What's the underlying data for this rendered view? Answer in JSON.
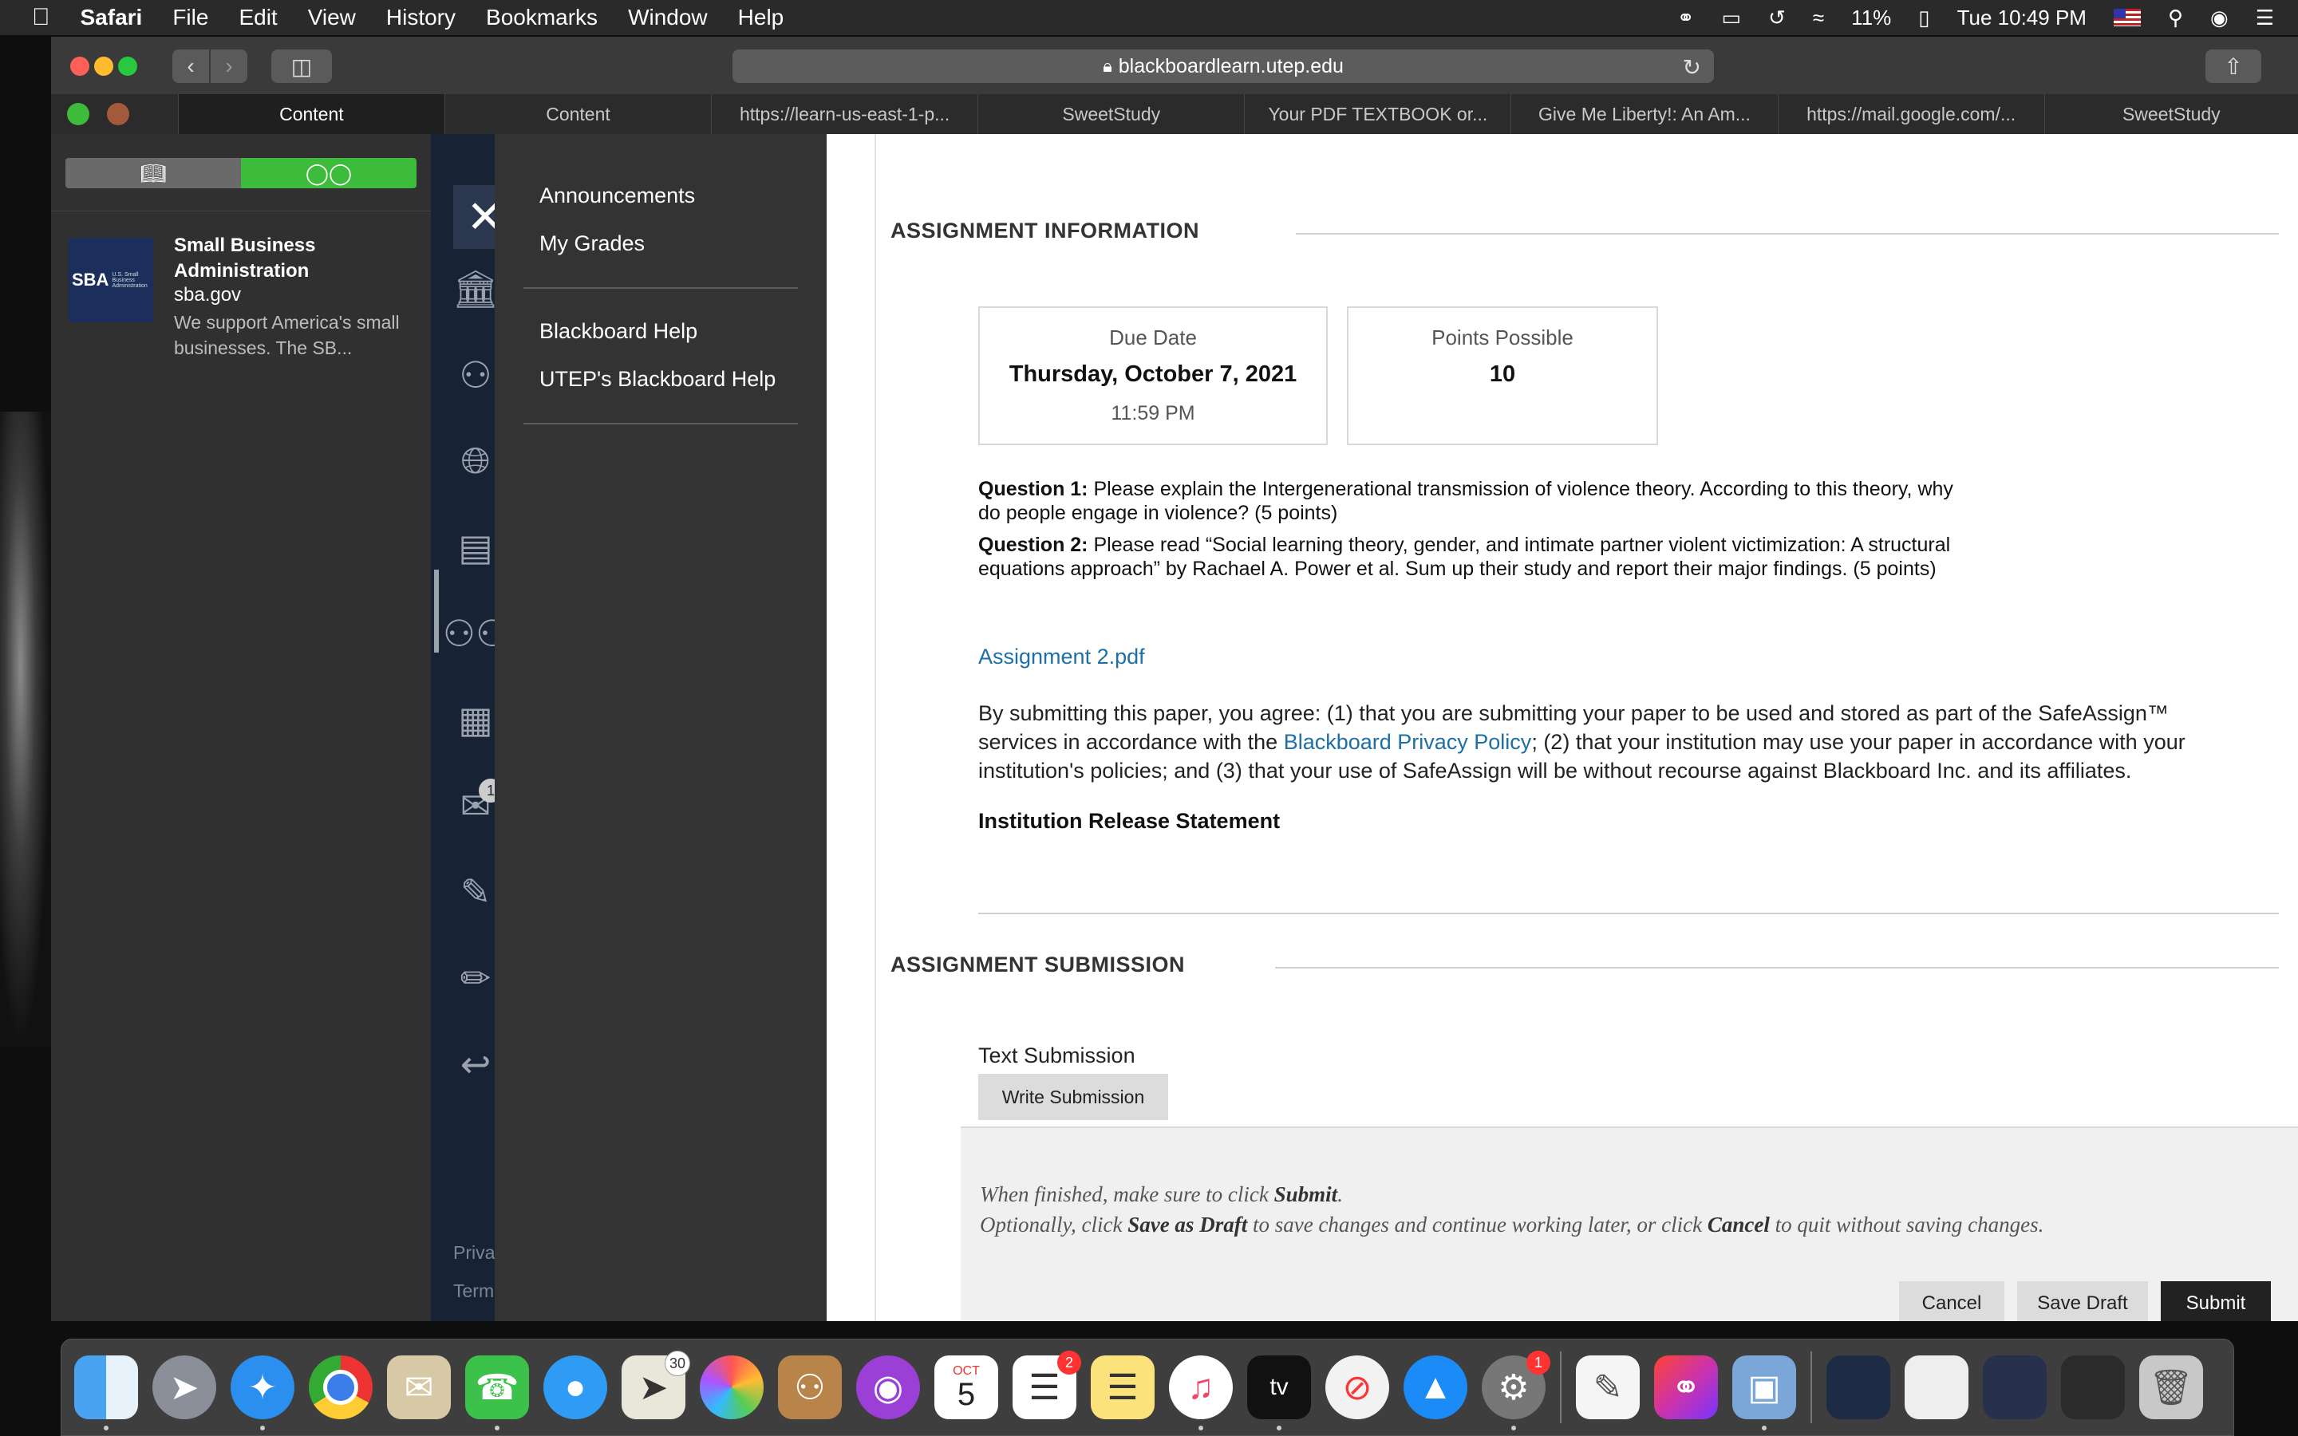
{
  "menubar": {
    "app_name": "Safari",
    "menus": [
      "File",
      "Edit",
      "View",
      "History",
      "Bookmarks",
      "Window",
      "Help"
    ],
    "battery": "11%",
    "clock": "Tue 10:49 PM"
  },
  "browser": {
    "url": "blackboardlearn.utep.edu",
    "tabs": [
      "Content",
      "Content",
      "https://learn-us-east-1-p...",
      "SweetStudy",
      "Your PDF TEXTBOOK or...",
      "Give Me Liberty!: An Am...",
      "https://mail.google.com/...",
      "SweetStudy"
    ]
  },
  "reading_list": {
    "thumb_text": "SBA",
    "thumb_small": "U.S. Small Business Administration",
    "item_title": "Small Business Administration",
    "item_domain": "sba.gov",
    "item_desc": "We support America's small businesses. The SB..."
  },
  "bb_rail": {
    "footer": [
      "Priva",
      "Term"
    ],
    "mail_badge": "1"
  },
  "bb_menu": {
    "items": [
      "Announcements",
      "My Grades",
      "Blackboard Help",
      "UTEP's Blackboard Help"
    ]
  },
  "assignment": {
    "info_heading": "ASSIGNMENT INFORMATION",
    "due_label": "Due Date",
    "due_date": "Thursday, October 7, 2021",
    "due_time": "11:59 PM",
    "points_label": "Points Possible",
    "points_value": "10",
    "q1_label": "Question 1:",
    "q1_text": " Please explain the Intergenerational transmission of violence theory. According to this theory, why do people engage in violence? (5 points)",
    "q2_label": "Question 2:",
    "q2_text": " Please read “Social learning theory, gender, and intimate partner violent victimization: A structural equations approach” by Rachael A. Power et al. Sum up their study and report their major findings. (5 points)",
    "attachment": "Assignment 2.pdf",
    "agree_before": "By submitting this paper, you agree: (1) that you are submitting your paper to be used and stored as part of the SafeAssign™ services in accordance with the ",
    "agree_link": "Blackboard Privacy Policy",
    "agree_after": "; (2) that your institution may use your paper in accordance with your institution's policies; and (3) that your use of SafeAssign will be without recourse against Blackboard Inc. and its affiliates.",
    "release_statement": "Institution Release Statement",
    "submission_heading": "ASSIGNMENT SUBMISSION",
    "text_submission_label": "Text Submission",
    "write_button": "Write Submission",
    "finish_l1_a": "When finished, make sure to click ",
    "finish_l1_b": "Submit",
    "finish_l1_c": ".",
    "finish_l2_a": "Optionally, click ",
    "finish_l2_b": "Save as Draft",
    "finish_l2_c": " to save changes and continue working later, or click ",
    "finish_l2_d": "Cancel",
    "finish_l2_e": " to quit without saving changes.",
    "cancel": "Cancel",
    "save_draft": "Save Draft",
    "submit": "Submit"
  },
  "dock": {
    "calendar_month": "OCT",
    "calendar_day": "5",
    "reminders_badge": "2",
    "prefs_badge": "1",
    "tv_label": "tv",
    "maps_badge": "30"
  },
  "colors": {
    "accent_link": "#1d6fa5",
    "reading_active": "#3dbb3a",
    "bb_rail": "#182235"
  }
}
